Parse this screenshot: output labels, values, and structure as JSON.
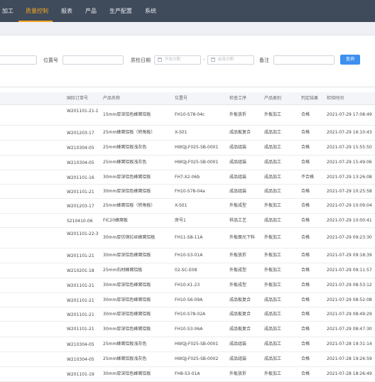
{
  "nav": {
    "items": [
      {
        "label": "加工",
        "active": false
      },
      {
        "label": "质量控制",
        "active": true
      },
      {
        "label": "报表",
        "active": false
      },
      {
        "label": "产品",
        "active": false
      },
      {
        "label": "生产配置",
        "active": false
      },
      {
        "label": "系统",
        "active": false
      }
    ],
    "active_color": "#f5a623",
    "background": "#3f4a5a"
  },
  "filters": {
    "position_label": "位置号",
    "position_value": "",
    "qc_date_label": "质检日期",
    "start_placeholder": "开始日期",
    "end_placeholder": "结束日期",
    "range_separator": "-",
    "remark_label": "备注",
    "remark_value": "",
    "query_button": "查询"
  },
  "table": {
    "columns": [
      "国际订单号",
      "产品名称",
      "位置号",
      "检查工序",
      "产品类别",
      "判定结果",
      "检验时间"
    ],
    "rows": [
      [
        "W201101-21-1",
        "15mm厚深铝色蜂窝铝板",
        "FH10-S78-04c",
        "外板放折",
        "外板加工",
        "合格",
        "2021-07-29 17:08:49"
      ],
      [
        "W201203-17",
        "25mm蜂窝铝板（转角板）",
        "X-S01",
        "成品板复合",
        "成品加工",
        "合格",
        "2021-07-29 16:10:43"
      ],
      [
        "W210304-05",
        "25mm蜂窝铝板浅灰色",
        "HWQJ-F025-SB-0001",
        "成品组装",
        "成品加工",
        "合格",
        "2021-07-29 15:55:50"
      ],
      [
        "W210304-05",
        "25mm蜂窝铝板浅灰色",
        "HWQJ-F025-SB-0001",
        "成品组装",
        "成品加工",
        "合格",
        "2021-07-29 15:49:06"
      ],
      [
        "W201101-16",
        "30mm厚深铝色蜂窝铝板",
        "FH7-X2-06b",
        "成品组装",
        "成品加工",
        "不合格",
        "2021-07-29 13:26:08"
      ],
      [
        "W201101-21",
        "30mm厚深铝色蜂窝铝板",
        "FH10-S78-04a",
        "成品组装",
        "成品加工",
        "合格",
        "2021-07-29 10:25:58"
      ],
      [
        "W201203-17",
        "25mm蜂窝铝板（转角板）",
        "X-S01",
        "外板成型",
        "外板加工",
        "合格",
        "2021-07-29 10:09:04"
      ],
      [
        "S210410-06",
        "FIC20蜂窝板",
        "房号1",
        "样品工艺",
        "成品加工",
        "合格",
        "2021-07-29 10:00:41"
      ],
      [
        "W201101-22-3",
        "30mm厚仿铜拉丝蜂窝铝板",
        "FH11-S8-11A",
        "外板面光下料",
        "外板加工",
        "合格",
        "2021-07-29 09:23:30"
      ],
      [
        "W201101-21",
        "30mm厚深铝色蜂窝铝板",
        "FH10-S3-01A",
        "外板放折",
        "外板加工",
        "合格",
        "2021-07-29 09:18:39"
      ],
      [
        "W210201-18",
        "25mm石材蜂窝铝板",
        "02-SC-E08",
        "外板成型",
        "外板加工",
        "合格",
        "2021-07-29 09:11:57"
      ],
      [
        "W201101-21",
        "30mm厚深铝色蜂窝铝板",
        "FH10-X1-23",
        "外板成型",
        "外板加工",
        "合格",
        "2021-07-29 08:53:12"
      ],
      [
        "W201101-21",
        "30mm厚深铝色蜂窝铝板",
        "FH10-S6-09A",
        "成品板复合",
        "成品加工",
        "合格",
        "2021-07-29 08:52:08"
      ],
      [
        "W201101-21",
        "30mm厚深铝色蜂窝铝板",
        "FH10-S78-02A",
        "成品板复合",
        "成品加工",
        "合格",
        "2021-07-29 08:49:29"
      ],
      [
        "W201101-21",
        "30mm厚深铝色蜂窝铝板",
        "FH10-S3-06A",
        "成品板复合",
        "成品加工",
        "合格",
        "2021-07-29 08:47:30"
      ],
      [
        "W210304-05",
        "25mm蜂窝铝板浅灰色",
        "HWQJ-F025-SB-0001",
        "成品组装",
        "成品加工",
        "合格",
        "2021-07-28 19:31:14"
      ],
      [
        "W210304-05",
        "25mm蜂窝铝板浅灰色",
        "HWQJ-F025-SB-0002",
        "成品组装",
        "成品加工",
        "合格",
        "2021-07-28 19:26:59"
      ],
      [
        "W201101-19",
        "30mm厚深铝色蜂窝铝板",
        "FH8-S3-01A",
        "外板放折",
        "外板加工",
        "合格",
        "2021-07-28 18:26:49"
      ]
    ]
  }
}
